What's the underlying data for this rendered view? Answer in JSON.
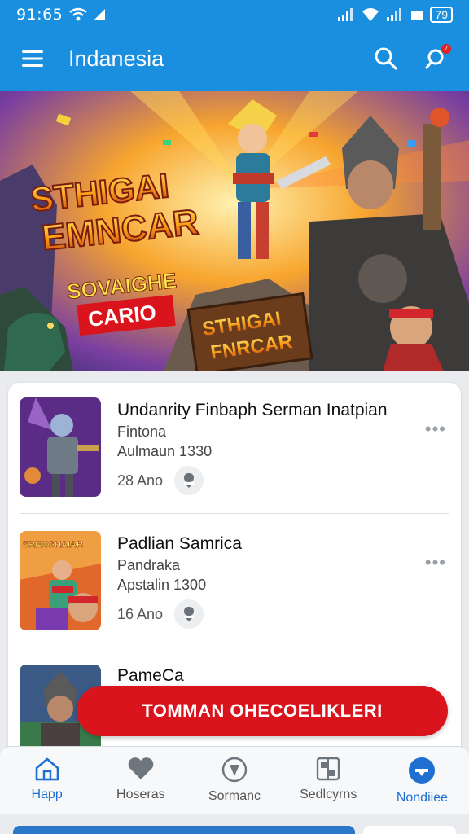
{
  "status": {
    "time": "91:65",
    "battery": "79"
  },
  "appbar": {
    "title": "Indanesia",
    "notification_count": "7"
  },
  "banner": {
    "logo_line1": "STHIGAI",
    "logo_line2": "EMNCAR",
    "tag_line1": "SOVAIGHE",
    "tag_line2": "CARIO",
    "sign_line1": "STHIGAI",
    "sign_line2": "FNRCAR"
  },
  "list": {
    "items": [
      {
        "title": "Undanrity Finbaph Serman Inatpian",
        "sub1": "Fintona",
        "sub2": "Aulmaun 1330",
        "age": "28 Ano",
        "thumb_color": "#5a2c86"
      },
      {
        "title": "Padlian Samrica",
        "sub1": "Pandraka",
        "sub2": "Apstalin 1300",
        "age": "16 Ano",
        "thumb_color": "#e0682a",
        "thumb_text": "SRENGHAIAR"
      },
      {
        "title": "PameCa",
        "sub1": "",
        "sub2": "",
        "age": "",
        "thumb_color": "#3b5b86"
      }
    ]
  },
  "cta": {
    "label": "TOMMAN OHECOELIKLERI"
  },
  "bottomnav": {
    "items": [
      {
        "label": "Happ",
        "icon": "home-icon",
        "active": true
      },
      {
        "label": "Hoseras",
        "icon": "heart-icon",
        "active": false
      },
      {
        "label": "Sormanc",
        "icon": "shield-icon",
        "active": false
      },
      {
        "label": "Sedlcyrns",
        "icon": "grid-icon",
        "active": false
      },
      {
        "label": "Nondiiee",
        "icon": "plus-circle-icon",
        "active": true
      }
    ]
  },
  "colors": {
    "primary": "#1a8fe0",
    "accent_red": "#d9141c",
    "nav_active": "#1e6fd0"
  }
}
